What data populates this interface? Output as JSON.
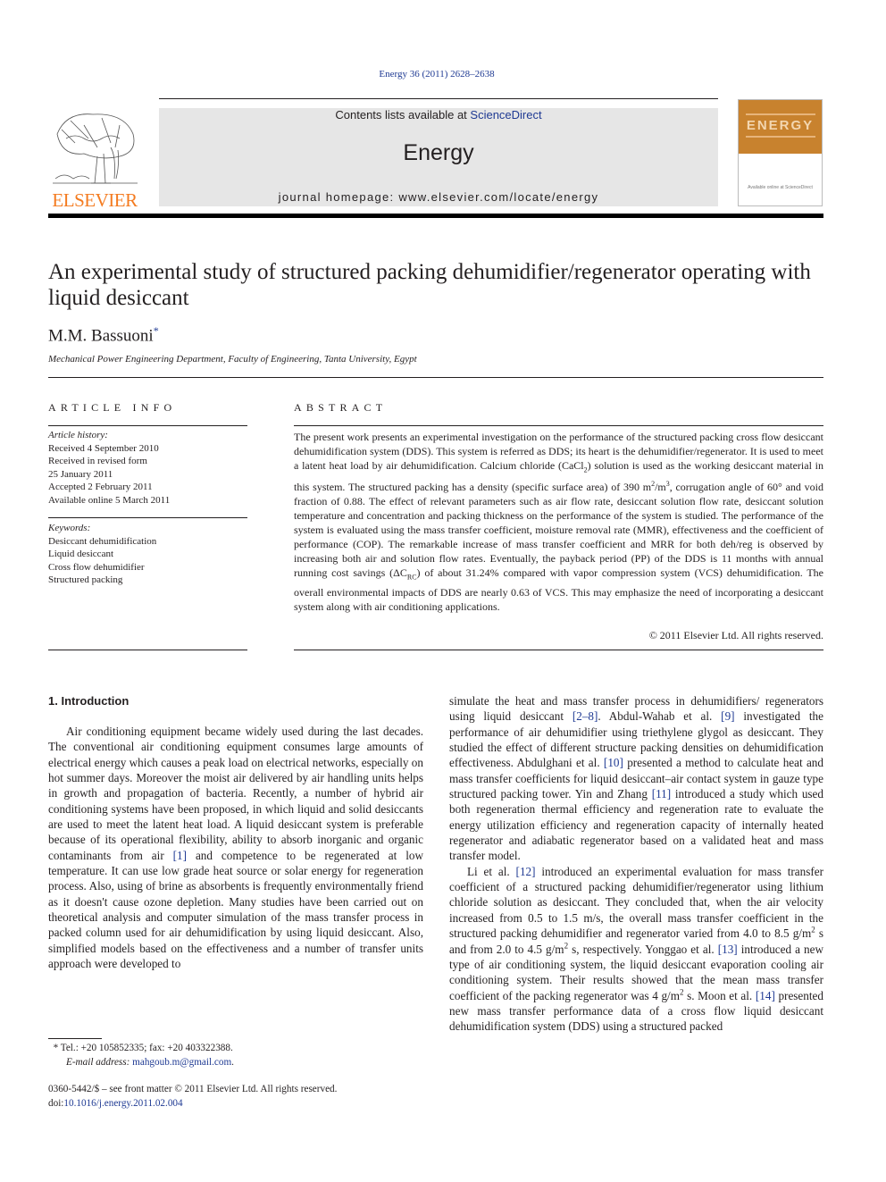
{
  "header": {
    "citation": "Energy 36 (2011) 2628–2638",
    "contents_prefix": "Contents lists available at ",
    "contents_link": "ScienceDirect",
    "journal_name": "Energy",
    "homepage_prefix": "journal homepage: ",
    "homepage_url": "www.elsevier.com/locate/energy",
    "publisher_logo_text": "ELSEVIER",
    "cover_title": "ENERGY",
    "cover_footer": "Available online at ScienceDirect",
    "colors": {
      "publisher_orange": "#f47b20",
      "link_blue": "#1f3a93",
      "banner_gray": "#e6e6e6",
      "cover_orange": "#c8822e"
    }
  },
  "article": {
    "title": "An experimental study of structured packing dehumidifier/regenerator operating with liquid desiccant",
    "author": "M.M. Bassuoni",
    "author_mark": "*",
    "affiliation": "Mechanical Power Engineering Department, Faculty of Engineering, Tanta University, Egypt"
  },
  "article_info": {
    "heading": "ARTICLE INFO",
    "history_label": "Article history:",
    "history": [
      "Received 4 September 2010",
      "Received in revised form",
      "25 January 2011",
      "Accepted 2 February 2011",
      "Available online 5 March 2011"
    ],
    "keywords_label": "Keywords:",
    "keywords": [
      "Desiccant dehumidification",
      "Liquid desiccant",
      "Cross flow dehumidifier",
      "Structured packing"
    ]
  },
  "abstract": {
    "heading": "ABSTRACT",
    "p1": "The present work presents an experimental investigation on the performance of the structured packing cross flow desiccant dehumidification system (DDS). This system is referred as DDS; its heart is the dehumidifier/regenerator. It is used to meet a latent heat load by air dehumidification. Calcium chloride (CaCl",
    "p1_sub": "2",
    "p2": ") solution is used as the working desiccant material in this system. The structured packing has a density (specific surface area) of 390 m",
    "p2_sup1": "2",
    "p3": "/m",
    "p3_sup": "3",
    "p4": ", corrugation angle of 60° and void fraction of 0.88. The effect of relevant parameters such as air flow rate, desiccant solution flow rate, desiccant solution temperature and concentration and packing thickness on the performance of the system is studied. The performance of the system is evaluated using the mass transfer coefficient, moisture removal rate (MMR), effectiveness and the coefficient of performance (COP). The remarkable increase of mass transfer coefficient and MRR for both deh/reg is observed by increasing both air and solution flow rates. Eventually, the payback period (PP) of the DDS is 11 months with annual running cost savings (ΔC",
    "p4_sub": "RC",
    "p5": ") of about 31.24% compared with vapor compression system (VCS) dehumidification. The overall environmental impacts of DDS are nearly 0.63 of VCS. This may emphasize the need of incorporating a desiccant system along with air conditioning applications.",
    "copyright": "© 2011 Elsevier Ltd. All rights reserved."
  },
  "introduction": {
    "heading": "1.  Introduction",
    "left": {
      "t1": "Air conditioning equipment became widely used during the last decades. The conventional air conditioning equipment consumes large amounts of electrical energy which causes a peak load on electrical networks, especially on hot summer days. Moreover the moist air delivered by air handling units helps in growth and propagation of bacteria. Recently, a number of hybrid air conditioning systems have been proposed, in which liquid and solid desiccants are used to meet the latent heat load. A liquid desiccant system is preferable because of its operational flexibility, ability to absorb inorganic and organic contaminants from air ",
      "r1": "[1]",
      "t2": " and competence to be regenerated at low temperature. It can use low grade heat source or solar energy for regeneration process. Also, using of brine as absorbents is frequently environmentally friend as it doesn't cause ozone depletion. Many studies have been carried out on theoretical analysis and computer simulation of the mass transfer process in packed column used for air dehumidification by using liquid desiccant. Also, simplified models based on the effectiveness and a number of transfer units approach were developed to"
    },
    "right_p1": {
      "t1": "simulate the heat and mass transfer process in dehumidifiers/ regenerators using liquid desiccant ",
      "r1": "[2–8]",
      "t2": ". Abdul-Wahab et al. ",
      "r2": "[9]",
      "t3": " investigated the performance of air dehumidifier using triethylene glygol as desiccant. They studied the effect of different structure packing densities on dehumidification effectiveness. Abdulghani et al. ",
      "r3": "[10]",
      "t4": " presented a method to calculate heat and mass transfer coefficients for liquid desiccant–air contact system in gauze type structured packing tower. Yin and Zhang ",
      "r4": "[11]",
      "t5": " introduced a study which used both regeneration thermal efficiency and regeneration rate to evaluate the energy utilization efficiency and regeneration capacity of internally heated regenerator and adiabatic regenerator based on a validated heat and mass transfer model."
    },
    "right_p2": {
      "t1": "Li et al. ",
      "r1": "[12]",
      "t2": " introduced an experimental evaluation for mass transfer coefficient of a structured packing dehumidifier/regenerator using lithium chloride solution as desiccant. They concluded that, when the air velocity increased from 0.5 to 1.5 m/s, the overall mass transfer coefficient in the structured packing dehumidifier and regenerator varied from 4.0 to 8.5 g/m",
      "s1": "2",
      "t3": " s and from 2.0 to 4.5 g/m",
      "s2": "2",
      "t4": " s, respectively. Yonggao et al. ",
      "r2": "[13]",
      "t5": " introduced a new type of air conditioning system, the liquid desiccant evaporation cooling air conditioning system. Their results showed that the mean mass transfer coefficient of the packing regenerator was 4 g/m",
      "s3": "2",
      "t6": " s. Moon et al. ",
      "r3": "[14]",
      "t7": " presented new mass transfer performance data of a cross flow liquid desiccant dehumidification system (DDS) using a structured packed"
    }
  },
  "footnote": {
    "mark": "*",
    "contact": " Tel.: +20 105852335; fax: +20 403322388.",
    "email_label": "E-mail address: ",
    "email": "mahgoub.m@gmail.com",
    "email_end": "."
  },
  "front_matter": {
    "issn_line": "0360-5442/$ – see front matter © 2011 Elsevier Ltd. All rights reserved.",
    "doi_label": "doi:",
    "doi": "10.1016/j.energy.2011.02.004"
  }
}
